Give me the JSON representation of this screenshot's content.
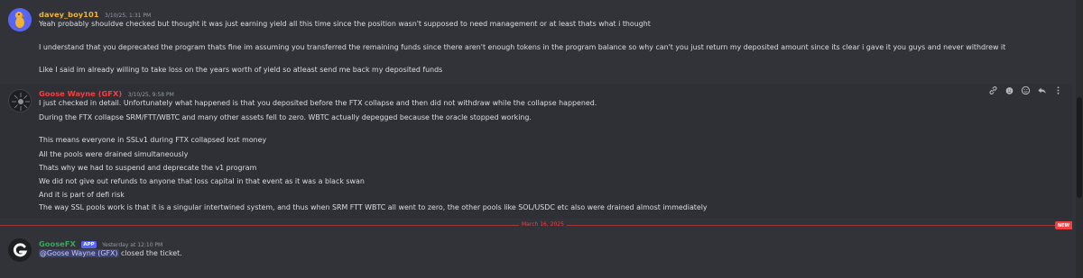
{
  "messages": [
    {
      "author": "davey_boy101",
      "author_color": "#f0b232",
      "timestamp": "3/10/25, 1:31 PM",
      "lines": [
        "Yeah probably shouldve checked but thought it was just earning yield all this time since the position wasn't supposed to need management or at least thats what i thought",
        "",
        "I understand that you deprecated the program thats fine im assuming you transferred the remaining funds since there aren't enough tokens in the program balance so why can't you just return my deposited amount since its clear i gave it you guys and never withdrew it",
        "",
        "Like I said im already willing to take loss on the years worth of yield so atleast send me back my deposited funds"
      ]
    },
    {
      "author": "Goose Wayne (GFX)",
      "author_color": "#f23f42",
      "timestamp": "3/10/25, 9:58 PM",
      "lines": [
        "I just checked in detail. Unfortunately what happened is that you deposited before the FTX collapse and then did not withdraw while the collapse happened.",
        "During the FTX collapse SRM/FTT/WBTC and many other assets fell to zero. WBTC actually depegged because the oracle stopped working.",
        "",
        "This means everyone in SSLv1 during FTX collapsed lost money",
        "All the pools were drained simultaneously",
        "Thats why we had to suspend and deprecate the v1 program",
        "We did not give out refunds to anyone that loss capital in that event as it was a black swan",
        "And it is part of defi risk",
        "The way SSL pools work is that it is a singular intertwined system, and thus when SRM FTT WBTC all went to zero, the other pools like SOL/USDC etc also were drained almost immediately"
      ],
      "toolbar_icons": [
        "link-icon",
        "add-reaction-icon",
        "emoji-icon",
        "reply-icon",
        "more-icon"
      ]
    }
  ],
  "divider": {
    "label": "March 16, 2025",
    "badge": "NEW"
  },
  "system_message": {
    "author": "GooseFX",
    "author_color": "#3ba55c",
    "app_tag": "APP",
    "timestamp": "Yesterday at 12:10 PM",
    "mention": "@Goose Wayne (GFX)",
    "text": " closed the ticket."
  }
}
